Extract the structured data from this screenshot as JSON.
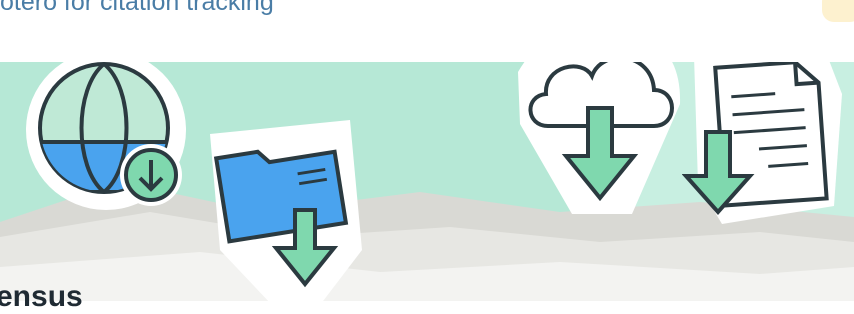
{
  "header": {
    "subtitle": "otero for citation tracking",
    "section_heading": "ensus"
  },
  "icons": [
    "globe-download-icon",
    "folder-download-icon",
    "cloud-download-icon",
    "document-download-icon"
  ],
  "colors": {
    "banner_mint": "#b6e8d6",
    "accent_blue": "#4aa3ee",
    "accent_green": "#7fd8ae",
    "outline": "#2b3a40",
    "subtitle_blue": "#4a7da6"
  }
}
